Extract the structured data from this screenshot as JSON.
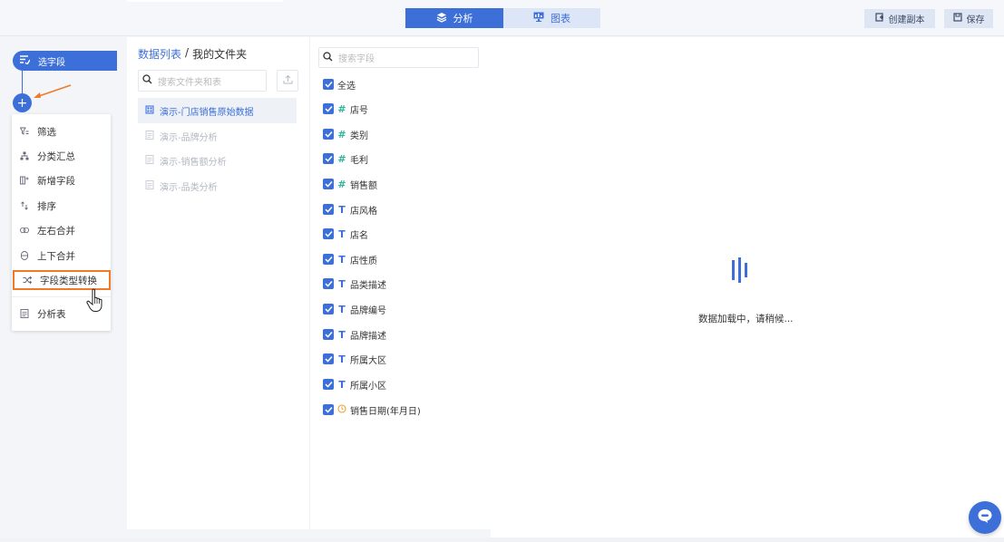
{
  "topbar": {
    "tabs": [
      {
        "label": "分析",
        "icon": "layers-icon",
        "active": true
      },
      {
        "label": "图表",
        "icon": "monitor-icon",
        "active": false
      }
    ],
    "copy_label": "创建副本",
    "save_label": "保存"
  },
  "steps": {
    "current_step": "选字段",
    "add_icon": "plus-icon",
    "menu": [
      {
        "label": "筛选",
        "icon": "filter-icon"
      },
      {
        "label": "分类汇总",
        "icon": "tree-icon"
      },
      {
        "label": "新增字段",
        "icon": "add-column-icon"
      },
      {
        "label": "排序",
        "icon": "sort-icon"
      },
      {
        "label": "左右合并",
        "icon": "join-icon"
      },
      {
        "label": "上下合并",
        "icon": "union-icon"
      },
      {
        "label": "字段类型转换",
        "icon": "shuffle-icon",
        "highlighted": true
      },
      {
        "label": "分析表",
        "icon": "table-doc-icon"
      }
    ]
  },
  "datalist": {
    "breadcrumb_root": "数据列表",
    "breadcrumb_sep": "/",
    "breadcrumb_current": "我的文件夹",
    "search_placeholder": "搜索文件夹和表",
    "items": [
      {
        "label": "演示-门店销售原始数据",
        "selected": true
      },
      {
        "label": "演示-品牌分析",
        "selected": false
      },
      {
        "label": "演示-销售额分析",
        "selected": false
      },
      {
        "label": "演示-品类分析",
        "selected": false
      }
    ]
  },
  "fields": {
    "search_placeholder": "搜索字段",
    "select_all": "全选",
    "items": [
      {
        "type": "#",
        "kind": "number",
        "label": "店号"
      },
      {
        "type": "#",
        "kind": "number",
        "label": "类别"
      },
      {
        "type": "#",
        "kind": "number",
        "label": "毛利"
      },
      {
        "type": "#",
        "kind": "number",
        "label": "销售额"
      },
      {
        "type": "T",
        "kind": "text",
        "label": "店风格"
      },
      {
        "type": "T",
        "kind": "text",
        "label": "店名"
      },
      {
        "type": "T",
        "kind": "text",
        "label": "店性质"
      },
      {
        "type": "T",
        "kind": "text",
        "label": "品类描述"
      },
      {
        "type": "T",
        "kind": "text",
        "label": "品牌编号"
      },
      {
        "type": "T",
        "kind": "text",
        "label": "品牌描述"
      },
      {
        "type": "T",
        "kind": "text",
        "label": "所属大区"
      },
      {
        "type": "T",
        "kind": "text",
        "label": "所属小区"
      },
      {
        "type": "clock",
        "kind": "date",
        "label": "销售日期(年月日)"
      }
    ]
  },
  "main": {
    "loading_text": "数据加载中，请稍候..."
  },
  "colors": {
    "accent": "#3d6fd9",
    "highlight_border": "#f07a2a",
    "number_type": "#2fb59c",
    "date_type": "#f0a030"
  }
}
